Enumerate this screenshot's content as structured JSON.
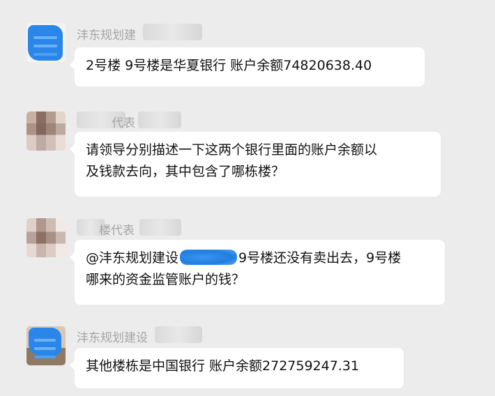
{
  "messages": [
    {
      "sender": "沣东规划建",
      "avatar_icon": "blue-scribbled-avatar-icon",
      "lines": [
        "2号楼 9号楼是华夏银行 账户余额74820638.40"
      ]
    },
    {
      "sender": "代表",
      "avatar_icon": "pixelated-avatar-icon",
      "lines": [
        "请领导分别描述一下这两个银行里面的账户余额以",
        "及钱款去向，其中包含了哪栋楼？"
      ]
    },
    {
      "sender": "楼代表",
      "avatar_icon": "pixelated-avatar-icon",
      "mention": "@沣东规划建设",
      "lines_after_mention": "9号楼还没有卖出去，9号楼",
      "lines": [
        "哪来的资金监管账户的钱？"
      ]
    },
    {
      "sender": "沣东规划建设",
      "avatar_icon": "blue-scribbled-avatar-icon",
      "lines": [
        "其他楼栋是中国银行 账户余额272759247.31"
      ]
    }
  ],
  "colors": {
    "background": "#ececec",
    "bubble": "#ffffff",
    "sender_text": "#a5a5a5",
    "redaction_blue": "#2a86e8"
  }
}
